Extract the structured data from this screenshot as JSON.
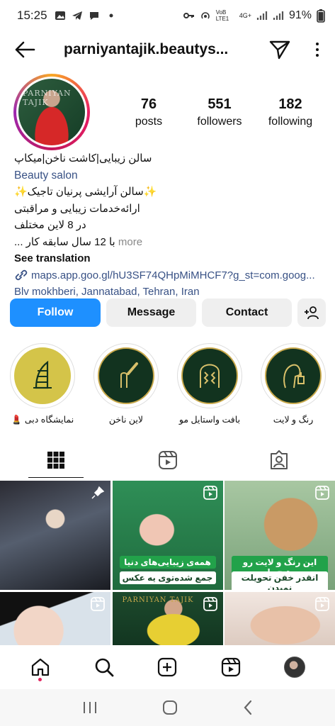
{
  "status_bar": {
    "time": "15:25",
    "net_label": "VoB LTE1",
    "gen_label": "4G+",
    "battery": "91%"
  },
  "header": {
    "username": "parniyantajik.beautys..."
  },
  "profile": {
    "avatar_logo": "PARNIYAN TAJIK",
    "posts_count": "76",
    "posts_label": "posts",
    "followers_count": "551",
    "followers_label": "followers",
    "following_count": "182",
    "following_label": "following"
  },
  "bio": {
    "line1": "سالن زیبایی|کاشت ناخن|میکاپ",
    "category": "Beauty salon",
    "line2": "✨سالن آرایشی پرنیان تاجیک✨",
    "line3": "ارائه‌خدمات زیبایی و مراقبتی",
    "line4": "در 8 لاین مختلف",
    "line5": "با 12 سال سابقه کار ...",
    "more": "more",
    "see_translation": "See translation",
    "link": "maps.app.goo.gl/hU3SF74QHpMiMHCF7?g_st=com.goog...",
    "address": "Blv mokhberi, Jannatabad, Tehran, Iran"
  },
  "buttons": {
    "follow": "Follow",
    "message": "Message",
    "contact": "Contact"
  },
  "highlights": [
    {
      "label": "نمایشگاه دبی 💄"
    },
    {
      "label": "لاین ناخن"
    },
    {
      "label": "بافت واستایل مو"
    },
    {
      "label": "رنگ و لایت"
    }
  ],
  "grid": {
    "post2_caption_top": "همه‌ی زیبایی‌های دنیا",
    "post2_caption_bottom": "جمع شده‌توی یه عکس",
    "post3_caption_top": "این رنگ و لایت رو هیچ‌جا",
    "post3_caption_bottom": "انقدر خفن تحویلت نمیدن",
    "post5_logo": "PARNIYAN TAJIK"
  },
  "colors": {
    "follow_button": "#1e90ff",
    "link": "#385185",
    "highlight_bg": "#12331f",
    "highlight_gold": "#d4c449"
  }
}
